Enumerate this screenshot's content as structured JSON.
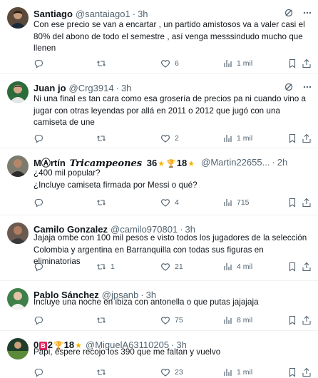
{
  "tweets": [
    {
      "name": "Santiago",
      "handle": "@santaiago1",
      "time": "3h",
      "text": "Con ese precio se van a encartar , un partido amistosos va a valer casi el 80% del abono de todo el semestre , así venga messsindudo mucho que llenen",
      "replies": "",
      "retweets": "",
      "likes": "6",
      "views": "1 mil"
    },
    {
      "name": "Juan jo",
      "handle": "@Crg3914",
      "time": "3h",
      "text": "Ni una final es tan cara como esa grosería de precios pa ni cuando vino a jugar con otras leyendas por allá en 2011 o 2012 que jugó con una camiseta de une",
      "replies": "",
      "retweets": "",
      "likes": "2",
      "views": "1 mil"
    },
    {
      "name_prefix": "M",
      "name_rest": "rtín",
      "name_fancy": "Tricampeones",
      "name_number1": "36",
      "name_number2": "18",
      "handle": "@Martin22655...",
      "time": "2h",
      "text": "¿400 mil popular?\n¿Incluye camiseta firmada por Messi o qué?",
      "replies": "",
      "retweets": "",
      "likes": "4",
      "views": "715"
    },
    {
      "name": "Camilo Gonzalez",
      "handle": "@camilo970801",
      "time": "3h",
      "text": "Jajaja ombe con 100 mil pesos e visto todos los jugadores de la selección Colombia y argentina en Barranquilla con todas sus figuras en eliminatorias",
      "replies": "",
      "retweets": "1",
      "likes": "21",
      "views": "4 mil"
    },
    {
      "name": "Pablo Sánchez",
      "handle": "@jpsanb",
      "time": "3h",
      "text": "Incluye una noche en ibiza con antonella o que putas jajajaja",
      "replies": "",
      "retweets": "",
      "likes": "75",
      "views": "8 mil"
    },
    {
      "name_prefix": "0",
      "name_badge": "B",
      "name_number1": "2",
      "name_number2": "18",
      "handle": "@MiguelA63110205",
      "time": "3h",
      "text": "Papi, espere recojo los 390 que me faltan y vuelvo",
      "replies": "",
      "retweets": "",
      "likes": "23",
      "views": "1 mil"
    }
  ],
  "colors": {
    "text": "#0f1419",
    "secondary": "#536471",
    "border": "#eff3f4"
  }
}
